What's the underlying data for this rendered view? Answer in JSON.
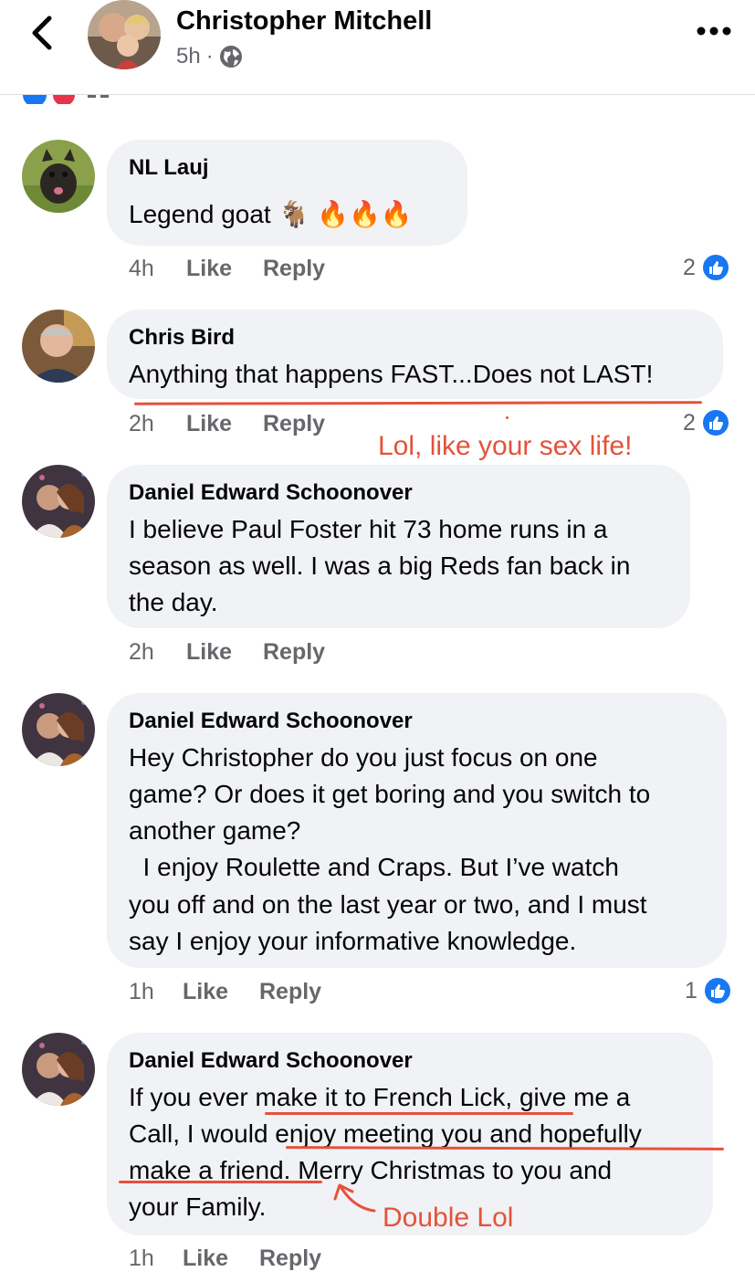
{
  "header": {
    "author": "Christopher Mitchell",
    "time": "5h",
    "separator": "·"
  },
  "comments": [
    {
      "author": "NL Lauj",
      "lines": [
        "Legend goat 🐐 🔥🔥🔥"
      ],
      "time": "4h",
      "like_label": "Like",
      "reply_label": "Reply",
      "likes": "2"
    },
    {
      "author": "Chris Bird",
      "lines": [
        "Anything that happens FAST...Does not LAST!"
      ],
      "time": "2h",
      "like_label": "Like",
      "reply_label": "Reply",
      "likes": "2"
    },
    {
      "author": "Daniel Edward Schoonover",
      "lines": [
        "I believe Paul Foster hit 73 home runs in a",
        "season as well. I was a big Reds fan back in",
        "the day."
      ],
      "time": "2h",
      "like_label": "Like",
      "reply_label": "Reply"
    },
    {
      "author": "Daniel Edward Schoonover",
      "lines": [
        "Hey Christopher do you just focus on one",
        "game? Or does it get boring and you switch to",
        "another game?",
        "  I enjoy Roulette and Craps. But I’ve watch",
        "you off and on the last year or two, and I must",
        "say I enjoy your informative knowledge."
      ],
      "time": "1h",
      "like_label": "Like",
      "reply_label": "Reply",
      "likes": "1"
    },
    {
      "author": "Daniel Edward Schoonover",
      "lines": [
        "If you ever make it to French Lick, give me a",
        "Call, I would enjoy meeting you and hopefully",
        "make a friend. Merry Christmas to you and",
        "your Family."
      ],
      "time": "1h",
      "like_label": "Like",
      "reply_label": "Reply"
    }
  ],
  "annotations": {
    "note_1": "Lol, like your sex life!",
    "note_2": "Double Lol",
    "color": "#e4523a"
  },
  "colors": {
    "bubble": "#f0f2f5",
    "like_blue": "#1877f2",
    "meta_gray": "#65676b"
  },
  "icons": {
    "back": "chevron-left-icon",
    "privacy": "globe-icon",
    "more": "more-dots-icon",
    "like": "thumbs-up-icon",
    "reaction_like": "like-reaction-icon",
    "reaction_love": "love-reaction-icon"
  }
}
